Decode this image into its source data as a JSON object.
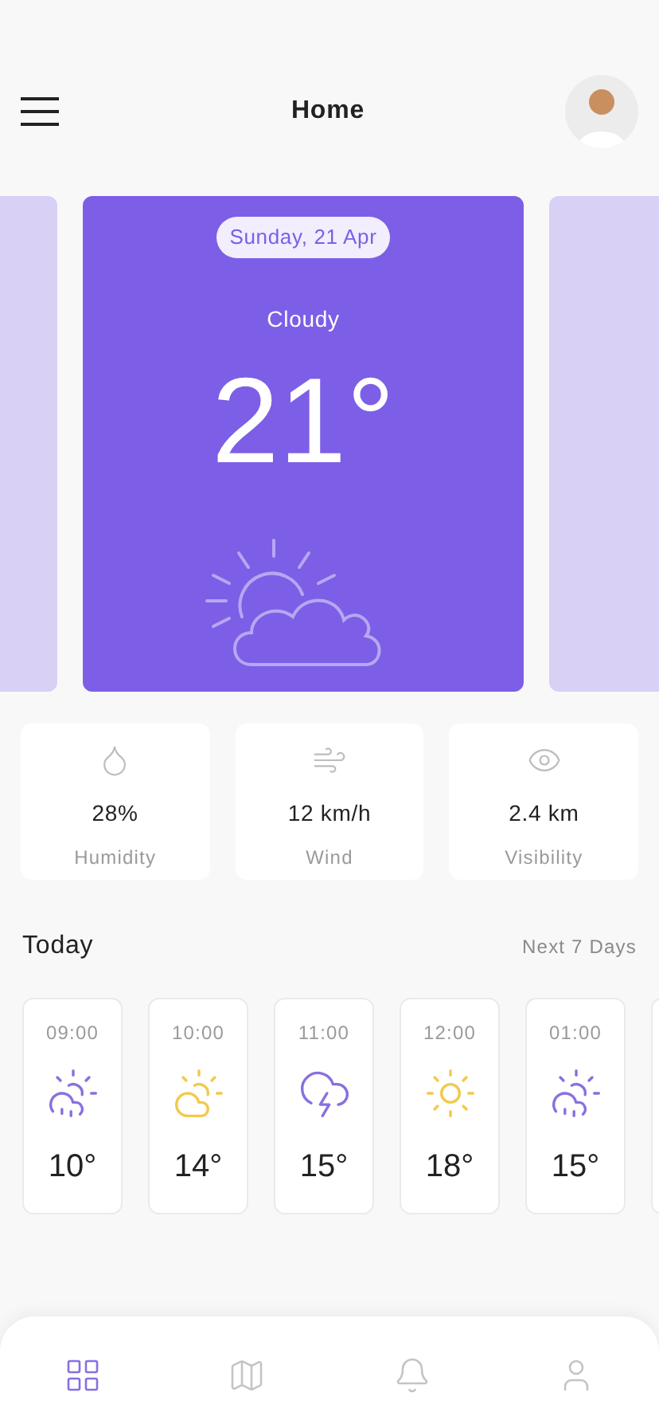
{
  "header": {
    "title": "Home"
  },
  "forecast": {
    "date": "Sunday, 21 Apr",
    "condition": "Cloudy",
    "temperature": "21°"
  },
  "stats": [
    {
      "kind": "humidity",
      "value": "28%",
      "label": "Humidity"
    },
    {
      "kind": "wind",
      "value": "12 km/h",
      "label": "Wind"
    },
    {
      "kind": "visibility",
      "value": "2.4 km",
      "label": "Visibility"
    }
  ],
  "today": {
    "title": "Today",
    "link": "Next 7 Days"
  },
  "hourly": [
    {
      "time": "09:00",
      "kind": "sun-cloud-rain",
      "temperature": "10°"
    },
    {
      "time": "10:00",
      "kind": "sun-cloud",
      "temperature": "14°"
    },
    {
      "time": "11:00",
      "kind": "storm",
      "temperature": "15°"
    },
    {
      "time": "12:00",
      "kind": "sun",
      "temperature": "18°"
    },
    {
      "time": "01:00",
      "kind": "sun-cloud-rain",
      "temperature": "15°"
    }
  ],
  "nav": [
    {
      "kind": "dashboard",
      "selected": true
    },
    {
      "kind": "map",
      "selected": false
    },
    {
      "kind": "notifications",
      "selected": false
    },
    {
      "kind": "profile",
      "selected": false
    }
  ]
}
